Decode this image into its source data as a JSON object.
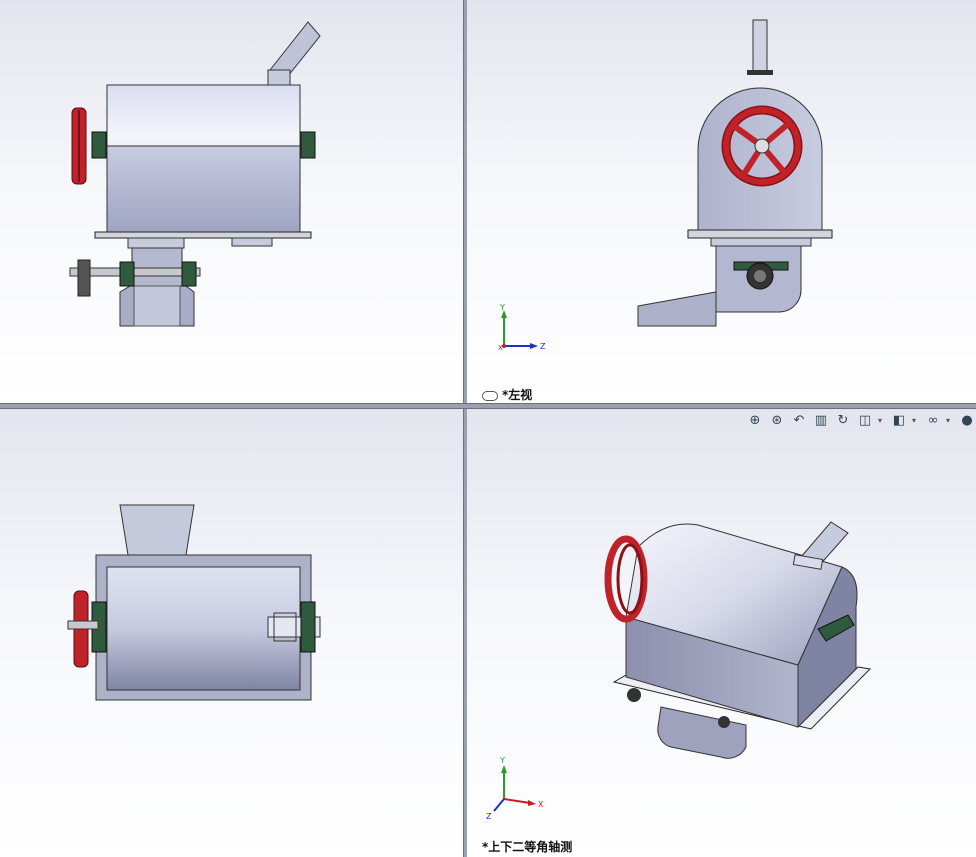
{
  "viewports": {
    "front": {
      "label": ""
    },
    "left": {
      "label": "*左视"
    },
    "top": {
      "label": ""
    },
    "iso": {
      "label": "*上下二等角轴测"
    }
  },
  "triad": {
    "x": "X",
    "y": "Y",
    "z": "Z"
  },
  "toolbar": {
    "icons": [
      "zoom-to-fit-icon",
      "zoom-to-area-icon",
      "previous-view-icon",
      "section-view-icon",
      "dynamic-annotation-icon",
      "view-orientation-icon",
      "display-style-icon",
      "hide-show-items-icon",
      "appearance-icon"
    ]
  },
  "colors": {
    "body": "#b7bdd6",
    "handwheel": "#c0222a",
    "bearing": "#2f5a3e",
    "background_top": "#e3e5ee"
  }
}
